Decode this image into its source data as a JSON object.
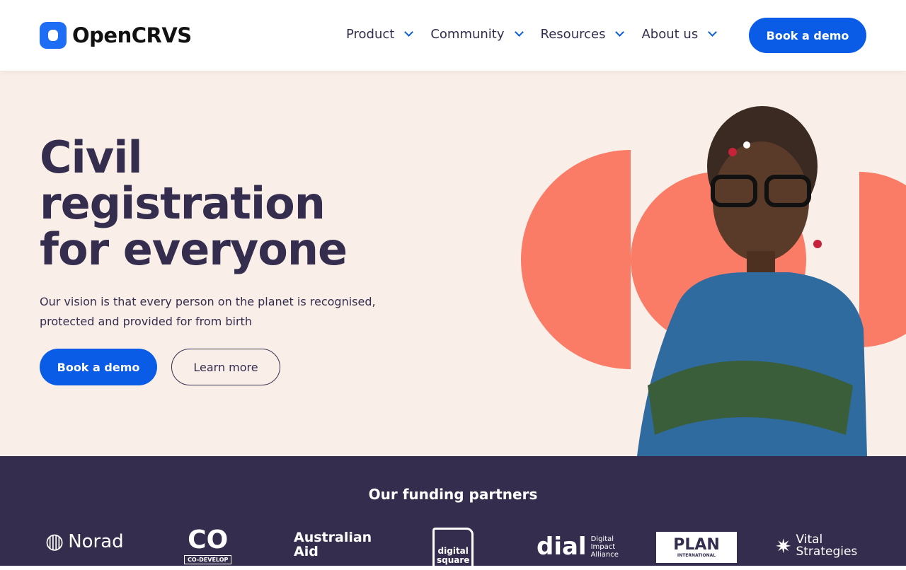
{
  "header": {
    "logo": "OpenCRVS",
    "nav": [
      {
        "label": "Product"
      },
      {
        "label": "Community"
      },
      {
        "label": "Resources"
      },
      {
        "label": "About us"
      }
    ],
    "cta": "Book a demo"
  },
  "hero": {
    "title": "Civil registration for everyone",
    "subtitle": "Our vision is that every person on the planet is recognised, protected and provided for from birth",
    "primary": "Book a demo",
    "secondary": "Learn more"
  },
  "funding": {
    "title": "Our funding partners",
    "partners": [
      {
        "name": "Norad"
      },
      {
        "name": "CO",
        "sub": "CO-DEVELOP"
      },
      {
        "name": "Australian Aid"
      },
      {
        "name": "digital square"
      },
      {
        "name": "dial",
        "sub": "Digital Impact Alliance"
      },
      {
        "name": "PLAN",
        "sub": "INTERNATIONAL"
      },
      {
        "name": "Vital Strategies"
      }
    ]
  },
  "colors": {
    "brand": "#0a5ce6",
    "dark": "#352d4e",
    "coral": "#fa7b66",
    "cream": "#f9efe8"
  }
}
